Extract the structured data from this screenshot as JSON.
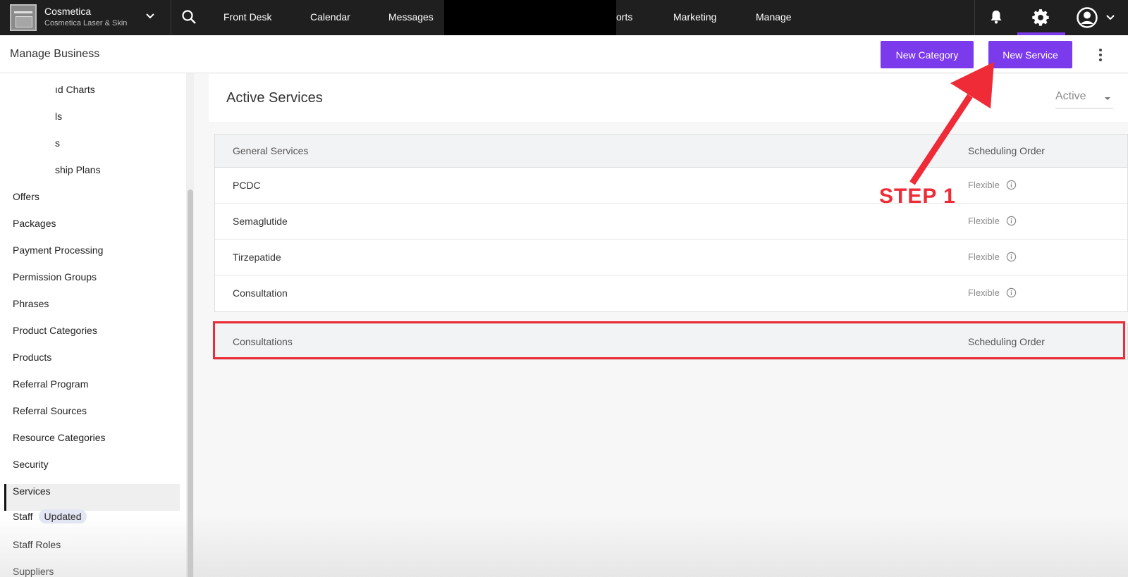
{
  "brand": {
    "name": "Cosmetica",
    "location": "Cosmetica Laser & Skin"
  },
  "nav": {
    "items": [
      "Front Desk",
      "Calendar",
      "Messages",
      "orts",
      "Marketing",
      "Manage"
    ]
  },
  "subheader": {
    "title": "Manage Business",
    "new_category": "New Category",
    "new_service": "New Service"
  },
  "sidebar": {
    "items": [
      "ıd Charts",
      "ls",
      "s",
      "ship Plans",
      "Offers",
      "Packages",
      "Payment Processing",
      "Permission Groups",
      "Phrases",
      "Product Categories",
      "Products",
      "Referral Program",
      "Referral Sources",
      "Resource Categories",
      "Security",
      "Services",
      "Staff",
      "Staff Roles",
      "Suppliers"
    ],
    "staff_badge": "Updated",
    "active_item": "Services"
  },
  "main": {
    "title": "Active Services",
    "status_filter": "Active",
    "categories": [
      {
        "name": "General Services",
        "order_header": "Scheduling Order",
        "services": [
          {
            "name": "PCDC",
            "order": "Flexible"
          },
          {
            "name": "Semaglutide",
            "order": "Flexible"
          },
          {
            "name": "Tirzepatide",
            "order": "Flexible"
          },
          {
            "name": "Consultation",
            "order": "Flexible"
          }
        ]
      },
      {
        "name": "Consultations",
        "order_header": "Scheduling Order"
      }
    ]
  },
  "annotation": {
    "label": "STEP 1",
    "color": "#ee2b36"
  },
  "colors": {
    "accent": "#7c3aed",
    "topnav": "#1f1f1f"
  }
}
